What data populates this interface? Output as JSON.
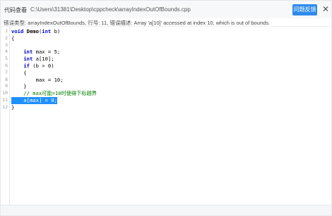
{
  "window": {
    "title": "代码查看",
    "separator": "-",
    "path": "C:\\Users\\31381\\Desktop\\cppcheck\\arrayIndexOutOfBounds.cpp",
    "issue_button": "问题反馈",
    "close_glyph": "✕"
  },
  "error_banner": "错误类型: arrayIndexOutOfBounds, 行号: 11, 错误描述: Array 'a[10]' accessed at index 10, which is out of bounds.",
  "code_lines": [
    {
      "num": "1",
      "fold": "",
      "text": "void Demo(int b)"
    },
    {
      "num": "2",
      "fold": "",
      "text": "{"
    },
    {
      "num": "3",
      "fold": "",
      "text": ""
    },
    {
      "num": "4",
      "fold": "",
      "text": "    int max = 5;"
    },
    {
      "num": "5",
      "fold": "",
      "text": "    int a[10];"
    },
    {
      "num": "6",
      "fold": "",
      "text": "    if (b > 0)"
    },
    {
      "num": "7",
      "fold": "",
      "text": "    {"
    },
    {
      "num": "8",
      "fold": "",
      "text": "        max = 10;"
    },
    {
      "num": "9",
      "fold": "",
      "text": "    }"
    },
    {
      "num": "10",
      "fold": "",
      "text": "    // max可能=10时使得下标越界"
    },
    {
      "num": "11",
      "fold": "",
      "text": "    a[max] = 0;"
    },
    {
      "num": "12",
      "fold": "",
      "text": "}"
    }
  ],
  "highlighted_line": "11",
  "colors": {
    "accent": "#2f8bea",
    "keyword": "#0000cc",
    "comment": "#008000",
    "selection": "#1e90ff"
  }
}
